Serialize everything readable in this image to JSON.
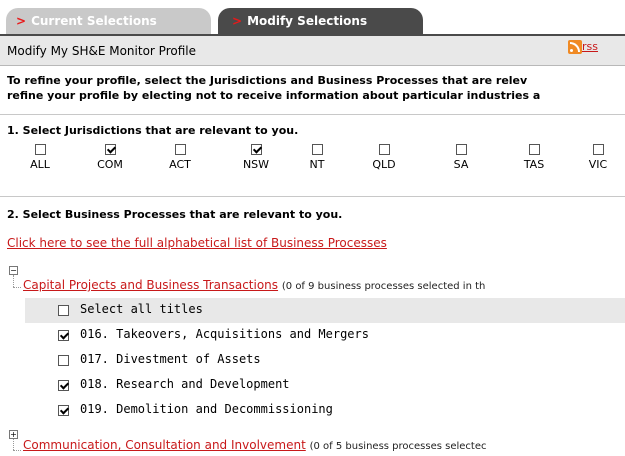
{
  "tabs": {
    "current": "Current Selections",
    "modify": "Modify Selections",
    "arrow": ">"
  },
  "header": {
    "title": "Modify My SH&E Monitor Profile",
    "rss_label": "rss"
  },
  "intro": {
    "line1": "To refine your profile, select the Jurisdictions and Business Processes that are relev",
    "line2": "refine your profile by electing not to receive information about particular industries a"
  },
  "section1": {
    "title": "1. Select Jurisdictions that are relevant to you.",
    "jurisdictions": [
      {
        "label": "ALL",
        "checked": false
      },
      {
        "label": "COM",
        "checked": true
      },
      {
        "label": "ACT",
        "checked": false
      },
      {
        "label": "NSW",
        "checked": true
      },
      {
        "label": "NT",
        "checked": false
      },
      {
        "label": "QLD",
        "checked": false
      },
      {
        "label": "SA",
        "checked": false
      },
      {
        "label": "TAS",
        "checked": false
      },
      {
        "label": "VIC",
        "checked": false
      }
    ]
  },
  "section2": {
    "title": "2. Select Business Processes that are relevant to you.",
    "alpha_link": "Click here to see the full alphabetical list of Business Processes",
    "groups": [
      {
        "expander": "−",
        "title": "Capital Projects and Business Transactions",
        "count": "(0 of 9 business processes selected in th",
        "select_all": "Select all titles",
        "items": [
          {
            "label": "016. Takeovers, Acquisitions and Mergers",
            "checked": true
          },
          {
            "label": "017. Divestment of Assets",
            "checked": false
          },
          {
            "label": "018. Research and Development",
            "checked": true
          },
          {
            "label": "019. Demolition and Decommissioning",
            "checked": true
          }
        ]
      },
      {
        "expander": "+",
        "title": "Communication, Consultation and Involvement",
        "count": "(0 of 5 business processes selectec"
      }
    ]
  }
}
